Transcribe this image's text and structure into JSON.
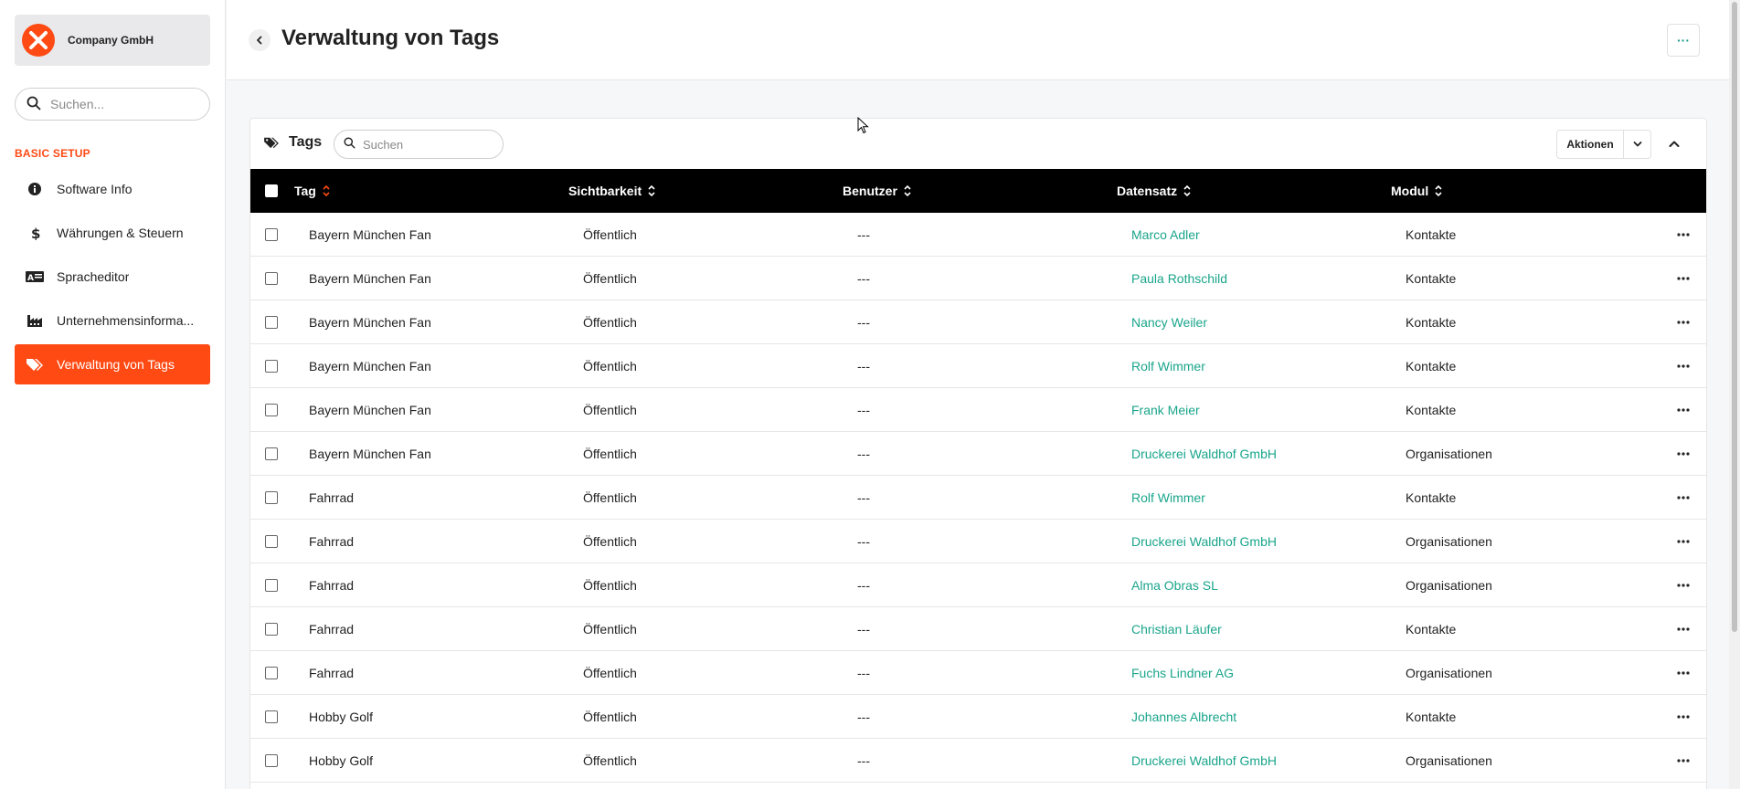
{
  "sidebar": {
    "company": "Company GmbH",
    "search_placeholder": "Suchen...",
    "section": "BASIC SETUP",
    "items": [
      {
        "label": "Software Info",
        "icon": "info-icon"
      },
      {
        "label": "Währungen & Steuern",
        "icon": "dollar-icon"
      },
      {
        "label": "Spracheditor",
        "icon": "language-icon"
      },
      {
        "label": "Unternehmensinforma...",
        "icon": "factory-icon"
      },
      {
        "label": "Verwaltung von Tags",
        "icon": "tags-icon",
        "active": true
      }
    ]
  },
  "header": {
    "title": "Verwaltung von Tags",
    "more": "···"
  },
  "card": {
    "title": "Tags",
    "search_placeholder": "Suchen",
    "actions_label": "Aktionen",
    "columns": [
      "Tag",
      "Sichtbarkeit",
      "Benutzer",
      "Datensatz",
      "Modul"
    ],
    "rows": [
      [
        "Bayern München Fan",
        "Öffentlich",
        "---",
        "Marco Adler",
        "Kontakte"
      ],
      [
        "Bayern München Fan",
        "Öffentlich",
        "---",
        "Paula Rothschild",
        "Kontakte"
      ],
      [
        "Bayern München Fan",
        "Öffentlich",
        "---",
        "Nancy Weiler",
        "Kontakte"
      ],
      [
        "Bayern München Fan",
        "Öffentlich",
        "---",
        "Rolf Wimmer",
        "Kontakte"
      ],
      [
        "Bayern München Fan",
        "Öffentlich",
        "---",
        "Frank Meier",
        "Kontakte"
      ],
      [
        "Bayern München Fan",
        "Öffentlich",
        "---",
        "Druckerei Waldhof GmbH",
        "Organisationen"
      ],
      [
        "Fahrrad",
        "Öffentlich",
        "---",
        "Rolf Wimmer",
        "Kontakte"
      ],
      [
        "Fahrrad",
        "Öffentlich",
        "---",
        "Druckerei Waldhof GmbH",
        "Organisationen"
      ],
      [
        "Fahrrad",
        "Öffentlich",
        "---",
        "Alma Obras SL",
        "Organisationen"
      ],
      [
        "Fahrrad",
        "Öffentlich",
        "---",
        "Christian Läufer",
        "Kontakte"
      ],
      [
        "Fahrrad",
        "Öffentlich",
        "---",
        "Fuchs Lindner AG",
        "Organisationen"
      ],
      [
        "Hobby Golf",
        "Öffentlich",
        "---",
        "Johannes Albrecht",
        "Kontakte"
      ],
      [
        "Hobby Golf",
        "Öffentlich",
        "---",
        "Druckerei Waldhof GmbH",
        "Organisationen"
      ]
    ]
  },
  "colors": {
    "accent": "#ff4a14",
    "link": "#1aa58b",
    "header_bg": "#000000"
  }
}
